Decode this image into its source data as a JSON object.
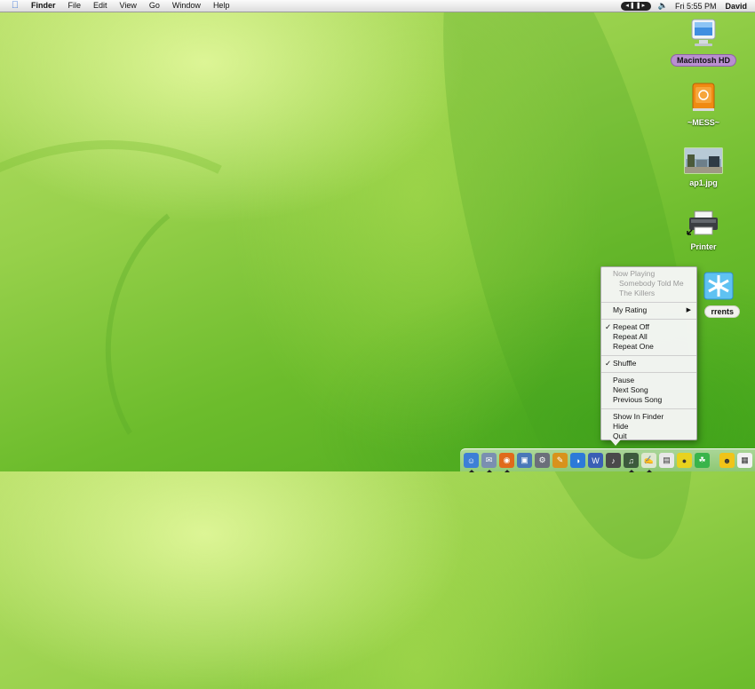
{
  "menubar": {
    "apple_icon": "apple-icon",
    "app_name": "Finder",
    "items": [
      "File",
      "Edit",
      "View",
      "Go",
      "Window",
      "Help"
    ],
    "clock": "Fri 5:55 PM",
    "user": "David",
    "status_icons": [
      "itunes-controls-icon",
      "volume-icon"
    ]
  },
  "desktop_icons": [
    {
      "label": "Macintosh HD",
      "icon": "hard-drive-icon",
      "selected": true
    },
    {
      "label": "~MESS~",
      "icon": "external-drive-icon",
      "selected": false
    },
    {
      "label": "ap1.jpg",
      "icon": "image-file-icon",
      "selected": false
    },
    {
      "label": "Printer",
      "icon": "printer-alias-icon",
      "selected": false
    },
    {
      "label": "rrents",
      "icon": "torrents-folder-icon",
      "selected": false
    }
  ],
  "context_menu": {
    "now_playing": {
      "header": "Now Playing",
      "song": "Somebody Told Me",
      "artist": "The Killers"
    },
    "my_rating": "My Rating",
    "repeat": [
      "Repeat Off",
      "Repeat All",
      "Repeat One"
    ],
    "repeat_checked": "Repeat Off",
    "shuffle": "Shuffle",
    "shuffle_checked": true,
    "playback": [
      "Pause",
      "Next Song",
      "Previous Song"
    ],
    "app": [
      "Show In Finder",
      "Hide",
      "Quit"
    ]
  },
  "dock": {
    "items": [
      {
        "name": "finder-icon",
        "color": "#3d7fd6",
        "running": true
      },
      {
        "name": "mail-icon",
        "color": "#7a8fb0",
        "running": true
      },
      {
        "name": "firefox-icon",
        "color": "#e06a1b",
        "running": true
      },
      {
        "name": "iphoto-icon",
        "color": "#4a78b8",
        "running": false
      },
      {
        "name": "system-prefs-icon",
        "color": "#6b6f7a",
        "running": false
      },
      {
        "name": "pixel-app-icon",
        "color": "#d8921c",
        "running": false
      },
      {
        "name": "dashboard-icon",
        "color": "#2d7ad8",
        "running": false
      },
      {
        "name": "word-icon",
        "color": "#3a5fb5",
        "running": false
      },
      {
        "name": "garageband-icon",
        "color": "#4a4a4a",
        "running": false
      },
      {
        "name": "itunes-icon",
        "color": "#3c5a3c",
        "running": true
      },
      {
        "name": "textedit-icon",
        "color": "#dfe7d0",
        "running": true
      },
      {
        "name": "preview-icon",
        "color": "#e8e8e8",
        "running": false
      },
      {
        "name": "adium-duck-icon",
        "color": "#e8d21e",
        "running": false
      },
      {
        "name": "azureus-frog-icon",
        "color": "#39b44a",
        "running": false
      },
      {
        "name": "ichat-icon",
        "color": "#f0c419",
        "running": false
      },
      {
        "name": "documents-stack-icon",
        "color": "#f2f2f2",
        "running": false
      },
      {
        "name": "trash-icon",
        "color": "#b9bcc0",
        "running": false
      }
    ]
  }
}
